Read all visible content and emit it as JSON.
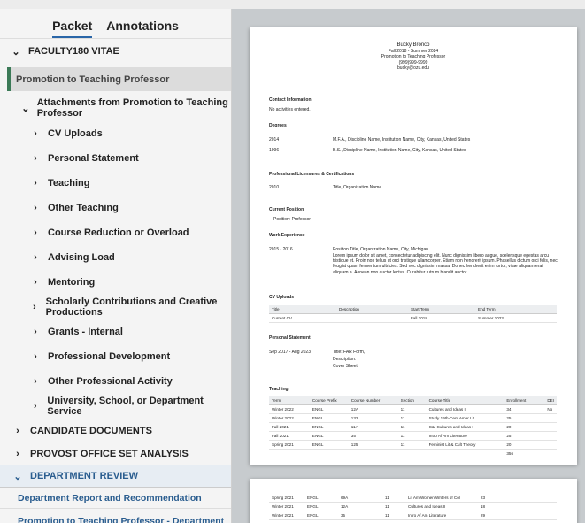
{
  "sidebar": {
    "tabs": [
      "Packet",
      "Annotations"
    ],
    "faculty": "FACULTY180 VITAE",
    "promotion": "Promotion to Teaching Professor",
    "attachments": "Attachments from Promotion to Teaching Professor",
    "sections": [
      "CV Uploads",
      "Personal Statement",
      "Teaching",
      "Other Teaching",
      "Course Reduction or Overload",
      "Advising Load",
      "Mentoring",
      "Scholarly Contributions and Creative Productions",
      "Grants - Internal",
      "Professional Development",
      "Other Professional Activity",
      "University, School, or Department Service"
    ],
    "candidate": "CANDIDATE DOCUMENTS",
    "provost": "PROVOST OFFICE SET ANALYSIS",
    "dept": "DEPARTMENT REVIEW",
    "link1": "Department Report and Recommendation",
    "link2": "Promotion to Teaching Professor - Department Report | Department Review"
  },
  "doc": {
    "name": "Bucky Bronco",
    "range": "Fall 2018 - Summer 2024",
    "title": "Promotion to Teaching Professor",
    "phone": "(999)999-9999",
    "email": "bucky@ozu.edu",
    "contact_h": "Contact Information",
    "contact": "No activities entered.",
    "degrees_h": "Degrees",
    "deg1_year": "2014",
    "deg1": "M.F.A., Discipline Name, Institution Name, City, Kansas, United States",
    "deg2_year": "1996",
    "deg2": "B.S., Discipline Name, Institution Name, City, Kansas, United States",
    "lic_h": "Professional Licensures & Certifications",
    "lic_year": "2010",
    "lic": "Title, Organization Name",
    "pos_h": "Current Position",
    "pos": "Position: Professor",
    "work_h": "Work Experience",
    "work_years": "2015 - 2016",
    "work_title": "Position Title, Organization Name, City, Michigan",
    "work_desc": "Lorem ipsum dolor sit amet, consectetur adipiscing elit. Nunc dignissim libero augue, scelerisque egestas arcu tristique et. Proin non tellus ut orci tristique ullamcorper. Etiam non hendrerit ipsum. Phasellus dictum orci felis, nec feugiat quam fermentum ultricies. Sed nec dignissim massa. Donec hendrerit enim tortor, vitae aliquam erat aliquam a. Aenean non auctor lectus. Curabitur rutrum blandit auctor.",
    "cv_h": "CV Uploads",
    "cv_cols": [
      "Title",
      "Description",
      "Start Term",
      "End Term"
    ],
    "cv_row": [
      "Current CV",
      "",
      "Fall 2018",
      "Summer 2023"
    ],
    "ps_h": "Personal Statement",
    "ps_dates": "Sep 2017 - Aug 2023",
    "ps_l1": "Title: FAR Form,",
    "ps_l2": "Description:",
    "ps_l3": "Cover Sheet",
    "teach_h": "Teaching",
    "teach_cols": [
      "Term",
      "Course Prefix",
      "Course Number",
      "Section",
      "Course Title",
      "Enrollment",
      "DEI"
    ],
    "teach_rows": [
      [
        "Winter 2022",
        "ENGL",
        "12A",
        "11",
        "Cultures and Ideas II",
        "34",
        "No"
      ],
      [
        "Winter 2022",
        "ENGL",
        "132",
        "11",
        "Study 19th-Cent Amer Lit",
        "25",
        ""
      ],
      [
        "Fall 2021",
        "ENGL",
        "11A",
        "11",
        "C&I Cultures and Ideas I",
        "20",
        ""
      ],
      [
        "Fall 2021",
        "ENGL",
        "35",
        "11",
        "Intro Af Am Literature",
        "25",
        ""
      ],
      [
        "Spring 2021",
        "ENGL",
        "125",
        "11",
        "Feminist Lit & Cult Theory",
        "20",
        ""
      ],
      [
        "",
        "",
        "",
        "",
        "",
        "356",
        ""
      ]
    ],
    "teach_rows2": [
      [
        "Spring 2021",
        "ENGL",
        "69A",
        "11",
        "Lit Am Women Writers of Col",
        "23",
        ""
      ],
      [
        "Winter 2021",
        "ENGL",
        "12A",
        "11",
        "Cultures and Ideas II",
        "18",
        ""
      ],
      [
        "Winter 2021",
        "ENGL",
        "35",
        "11",
        "Intro Af Am Literature",
        "29",
        ""
      ]
    ]
  }
}
